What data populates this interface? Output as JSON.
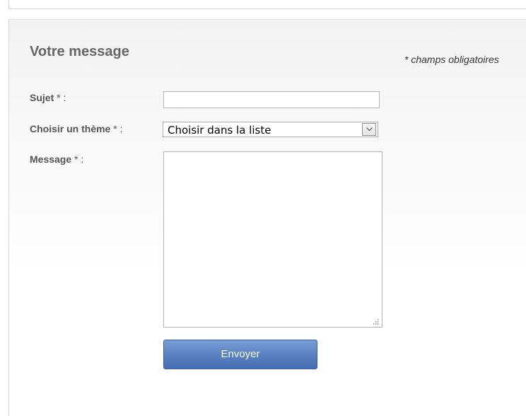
{
  "form": {
    "title": "Votre message",
    "required_note": "* champs obligatoires",
    "subject": {
      "label": "Sujet",
      "required_mark": " * :",
      "value": ""
    },
    "theme": {
      "label": "Choisir un thème",
      "required_mark": " * :",
      "selected_value": "Choisir dans la liste"
    },
    "message": {
      "label": "Message",
      "required_mark": " * :",
      "value": ""
    },
    "submit_label": "Envoyer"
  },
  "colors": {
    "button_blue": "#5a82c2",
    "label_gray": "#555555",
    "title_gray": "#666666"
  },
  "icons": {
    "select_arrow": "chevron-down-icon",
    "textarea_grip": "resize-grip-icon"
  }
}
